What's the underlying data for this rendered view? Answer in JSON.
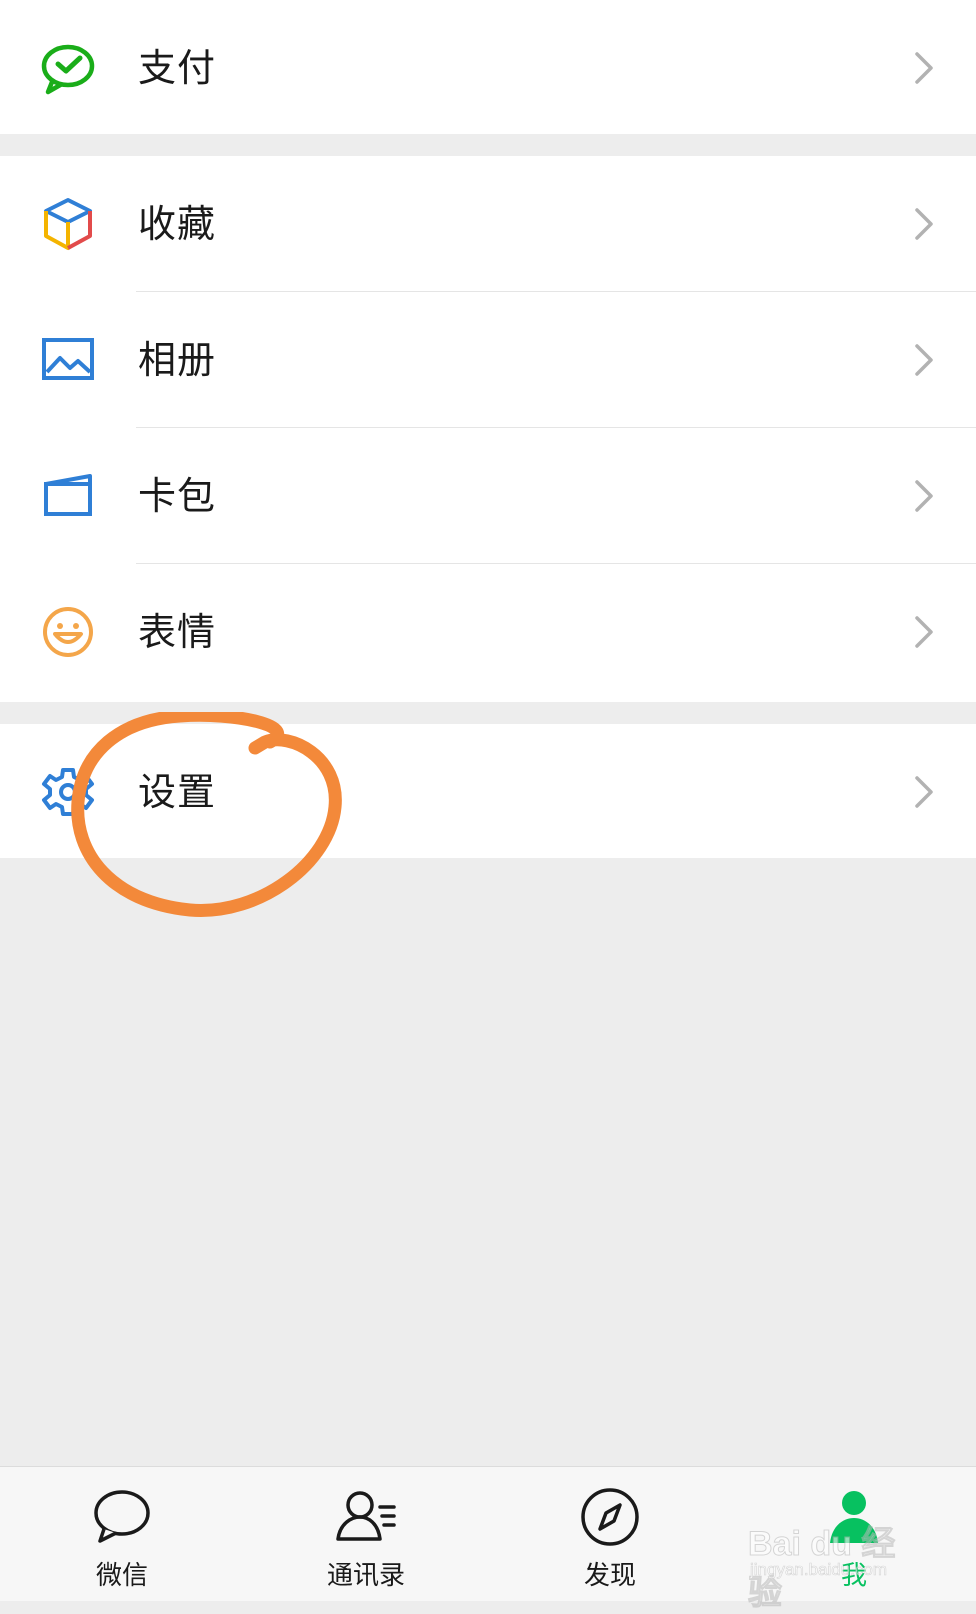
{
  "menu": {
    "groups": [
      [
        {
          "label": "支付",
          "icon": "pay-icon"
        }
      ],
      [
        {
          "label": "收藏",
          "icon": "favorites-cube-icon"
        },
        {
          "label": "相册",
          "icon": "album-image-icon"
        },
        {
          "label": "卡包",
          "icon": "card-wallet-icon"
        },
        {
          "label": "表情",
          "icon": "sticker-smiley-icon"
        }
      ],
      [
        {
          "label": "设置",
          "icon": "settings-gear-icon"
        }
      ]
    ]
  },
  "tabbar": {
    "tabs": [
      {
        "label": "微信",
        "icon": "chat-bubble-icon",
        "active": false
      },
      {
        "label": "通讯录",
        "icon": "contacts-icon",
        "active": false
      },
      {
        "label": "发现",
        "icon": "compass-icon",
        "active": false
      },
      {
        "label": "我",
        "icon": "me-person-icon",
        "active": true
      }
    ]
  },
  "watermark": {
    "brand": "Bai du 经验",
    "url": "jingyan.baidu.com"
  },
  "colors": {
    "accent": "#07c160",
    "annotation": "#f3893a",
    "pay": "#1aad19",
    "album": "#2f7fd6",
    "sticker": "#f4a64a",
    "settings": "#2f7fd6"
  }
}
